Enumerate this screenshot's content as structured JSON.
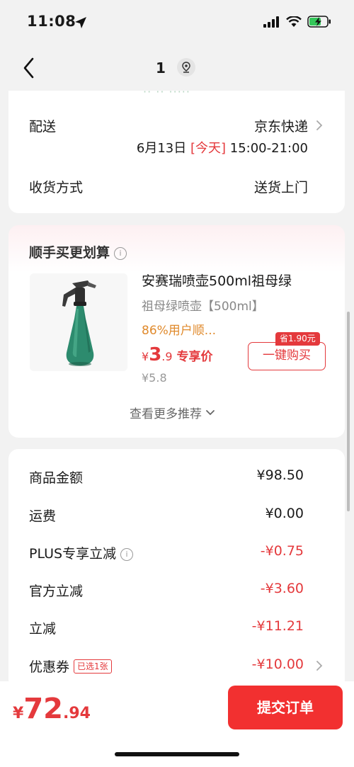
{
  "status_bar": {
    "time": "11:08"
  },
  "nav": {
    "title": "1"
  },
  "delivery": {
    "faded_text": "·· ·· ·····",
    "delivery_label": "配送",
    "delivery_value": "京东快递",
    "date": "6月13日",
    "today": "[今天]",
    "time_range": "15:00-21:00",
    "receive_label": "收货方式",
    "receive_value": "送货上门"
  },
  "addon": {
    "title": "顺手买更划算",
    "info_icon": "i",
    "product_name": "安赛瑞喷壶500ml祖母绿",
    "spec": "祖母绿喷壶【500ml】",
    "tag": "86%用户顺...",
    "price_yen": "¥",
    "price_int": "3",
    "price_dec": ".9",
    "price_label": "专享价",
    "original_price": "¥5.8",
    "save_badge": "省1.90元",
    "buy_button": "一键购买",
    "more_link": "查看更多推荐"
  },
  "summary": {
    "rows": [
      {
        "label": "商品金额",
        "value": "¥98.50"
      },
      {
        "label": "运费",
        "value": "¥0.00"
      },
      {
        "label": "PLUS专享立减",
        "value": "-¥0.75"
      },
      {
        "label": "官方立减",
        "value": "-¥3.60"
      },
      {
        "label": "立减",
        "value": "-¥11.21"
      },
      {
        "label": "优惠券",
        "value": "-¥10.00",
        "badge": "已选1张"
      }
    ]
  },
  "bottom": {
    "total_yen": "¥",
    "total_int": "72",
    "total_dec": ".94",
    "submit": "提交订单"
  },
  "colors": {
    "accent_red": "#e4393c",
    "button_red": "#f23030",
    "tag_orange": "#e08a2c",
    "background": "#f2f2f2"
  }
}
